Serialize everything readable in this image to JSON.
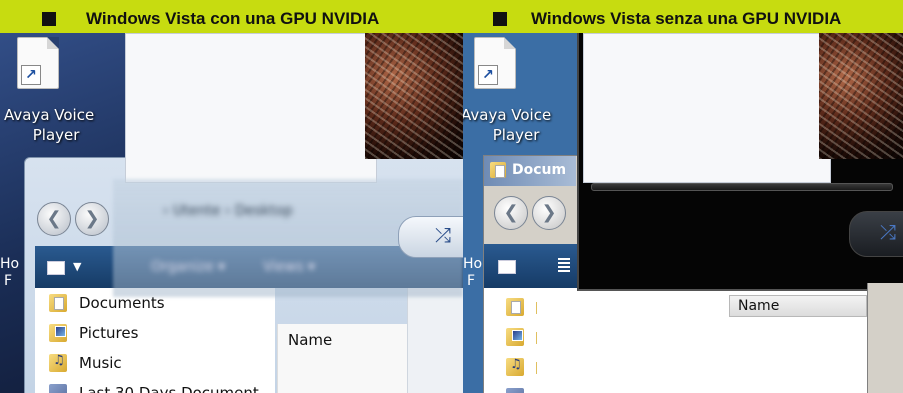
{
  "left_panel": {
    "heading": "Windows Vista con una GPU NVIDIA",
    "desktop_icon": {
      "line1": "Avaya Voice",
      "line2": "Player"
    },
    "side_label": {
      "line1": "Ho",
      "line2": "F"
    },
    "nav_items": [
      "Documents",
      "Pictures",
      "Music",
      "Last 30 Days Document"
    ],
    "column_header": "Name",
    "toolbar_blur": {
      "address": "› Utente › Desktop",
      "organize": "Organize ▾",
      "views": "Views ▾"
    }
  },
  "right_panel": {
    "heading": "Windows Vista senza una GPU NVIDIA",
    "desktop_icon": {
      "line1": "Avaya Voice",
      "line2": "Player"
    },
    "side_label": {
      "line1": "Ho",
      "line2": "F"
    },
    "window_title": "Docum",
    "column_header": "Name"
  },
  "colors": {
    "heading_bg": "#c7dc10",
    "vista_desktop": "#1a2d55",
    "classic_desktop": "#3b6ea5",
    "toolbar": "#1f4a7a"
  }
}
